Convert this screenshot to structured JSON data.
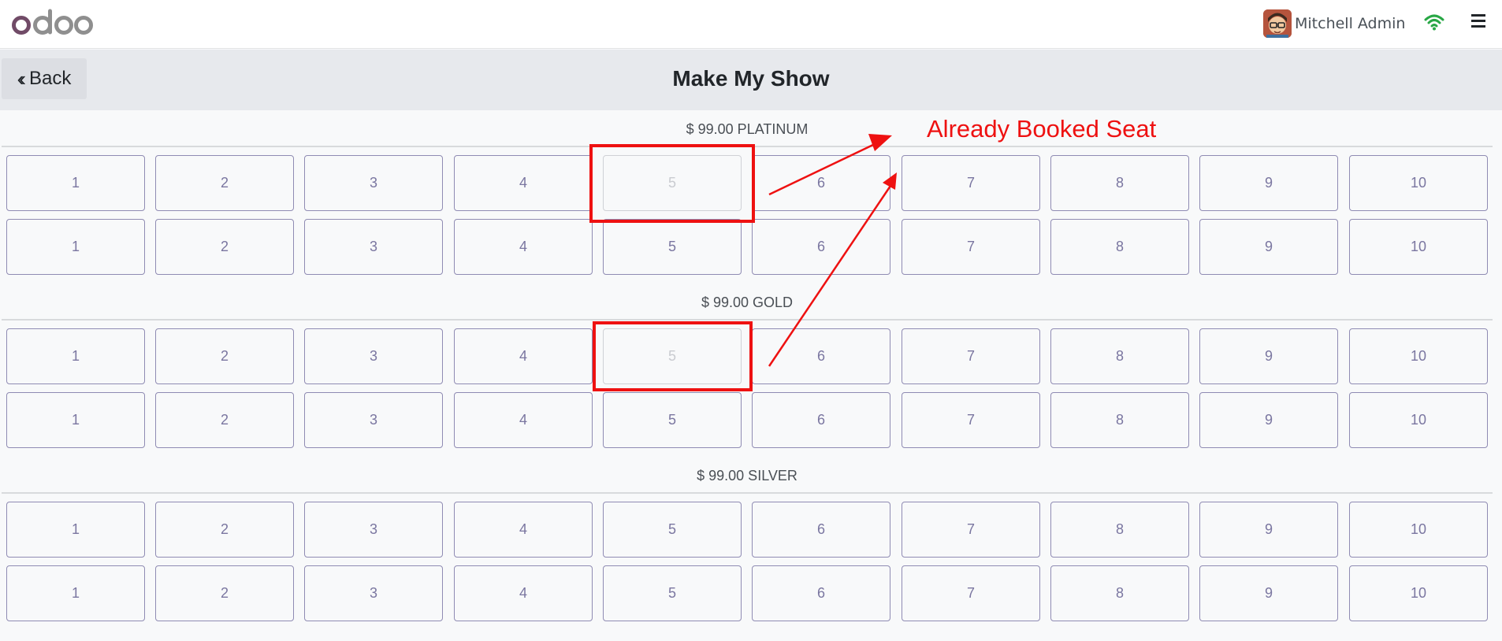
{
  "app": {
    "logo_text": "odoo"
  },
  "header": {
    "user_name": "Mitchell Admin",
    "avatar_icon": "avatar-icon",
    "network_icon": "wifi-icon",
    "menu_icon": "hamburger-icon"
  },
  "control": {
    "back_label": "Back",
    "back_icon": "double-chevron-left-icon",
    "title": "Make My Show"
  },
  "sections": [
    {
      "label": "$ 99.00 PLATINUM",
      "rows": [
        [
          "1",
          "2",
          "3",
          "4",
          "5",
          "6",
          "7",
          "8",
          "9",
          "10"
        ],
        [
          "1",
          "2",
          "3",
          "4",
          "5",
          "6",
          "7",
          "8",
          "9",
          "10"
        ]
      ],
      "booked": [
        {
          "row": 0,
          "seat": "5"
        }
      ]
    },
    {
      "label": "$ 99.00 GOLD",
      "rows": [
        [
          "1",
          "2",
          "3",
          "4",
          "5",
          "6",
          "7",
          "8",
          "9",
          "10"
        ],
        [
          "1",
          "2",
          "3",
          "4",
          "5",
          "6",
          "7",
          "8",
          "9",
          "10"
        ]
      ],
      "booked": [
        {
          "row": 0,
          "seat": "5"
        }
      ]
    },
    {
      "label": "$ 99.00 SILVER",
      "rows": [
        [
          "1",
          "2",
          "3",
          "4",
          "5",
          "6",
          "7",
          "8",
          "9",
          "10"
        ],
        [
          "1",
          "2",
          "3",
          "4",
          "5",
          "6",
          "7",
          "8",
          "9",
          "10"
        ]
      ],
      "booked": []
    }
  ],
  "annotation": {
    "text": "Already Booked Seat",
    "color": "#ee1111"
  },
  "colors": {
    "brand": "#714b67",
    "seat_border": "#8f8bb3",
    "booked_border": "#cfd1d6",
    "wifi": "#28a745"
  }
}
